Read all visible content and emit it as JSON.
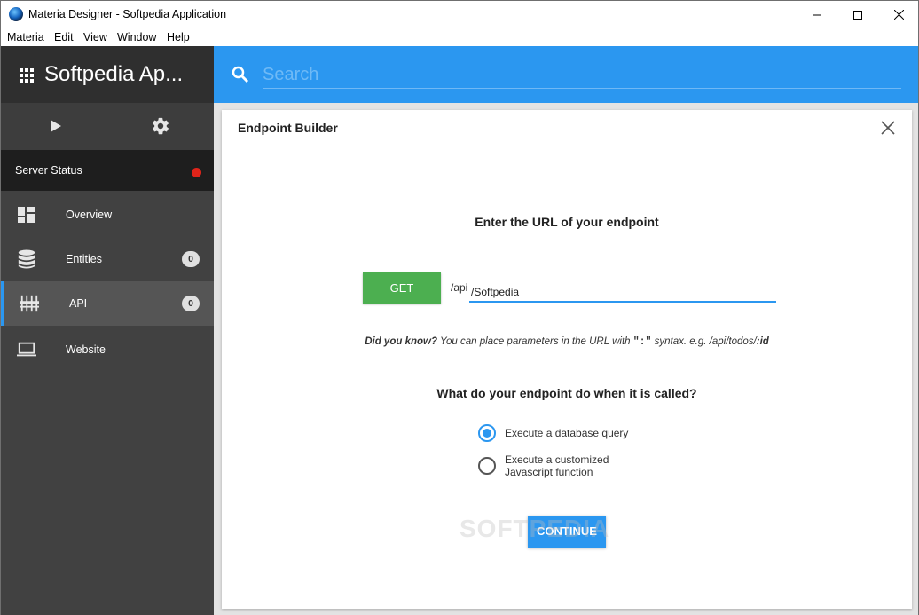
{
  "window": {
    "title": "Materia Designer - Softpedia Application",
    "minimize_icon": "minimize-icon",
    "maximize_icon": "maximize-icon",
    "close_icon": "close-icon"
  },
  "menu": [
    "Materia",
    "Edit",
    "View",
    "Window",
    "Help"
  ],
  "sidebar": {
    "app_title": "Softpedia Ap...",
    "server_status": "Server Status",
    "status_color": "#e0241a",
    "items": [
      {
        "label": "Overview",
        "icon": "dashboard-icon"
      },
      {
        "label": "Entities",
        "icon": "database-icon",
        "badge": "0"
      },
      {
        "label": "API",
        "icon": "api-icon",
        "badge": "0",
        "active": true
      },
      {
        "label": "Website",
        "icon": "laptop-icon"
      }
    ]
  },
  "search": {
    "placeholder": "Search"
  },
  "dialog": {
    "title": "Endpoint Builder",
    "url_heading": "Enter the URL of your endpoint",
    "method": "GET",
    "url_prefix": "/api",
    "url_value": "/Softpedia",
    "hint_bold": "Did you know?",
    "hint_text": " You can place parameters in the URL with ",
    "hint_code": "\":\"",
    "hint_text2": " syntax. e.g. /api/todos/",
    "hint_bold2": ":id",
    "question": "What do your endpoint do when it is called?",
    "options": [
      {
        "label": "Execute a database query",
        "checked": true
      },
      {
        "label_line1": "Execute a customized",
        "label_line2": "Javascript function",
        "checked": false
      }
    ],
    "continue_label": "CONTINUE",
    "watermark": "SOFTPEDIA"
  },
  "colors": {
    "accent": "#2b97f0",
    "get_button": "#4caf50",
    "sidebar_bg": "#414141"
  }
}
